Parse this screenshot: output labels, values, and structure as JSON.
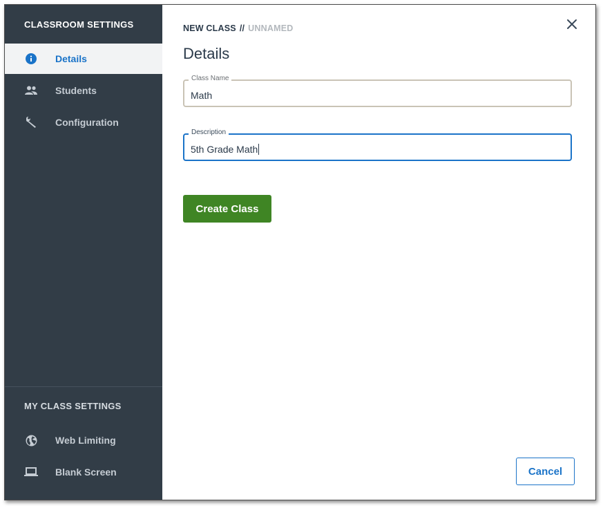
{
  "sidebar": {
    "heading": "CLASSROOM SETTINGS",
    "items": [
      {
        "label": "Details",
        "icon": "info-icon",
        "active": true
      },
      {
        "label": "Students",
        "icon": "people-icon",
        "active": false
      },
      {
        "label": "Configuration",
        "icon": "wrench-icon",
        "active": false
      }
    ],
    "my_heading": "MY CLASS SETTINGS",
    "my_items": [
      {
        "label": "Web Limiting",
        "icon": "globe-icon"
      },
      {
        "label": "Blank Screen",
        "icon": "laptop-icon"
      }
    ]
  },
  "breadcrumb": {
    "current": "NEW CLASS",
    "separator": "//",
    "name": "UNNAMED"
  },
  "page": {
    "title": "Details"
  },
  "form": {
    "class_name": {
      "label": "Class Name",
      "value": "Math"
    },
    "description": {
      "label": "Description",
      "value": "5th Grade Math"
    }
  },
  "buttons": {
    "create": "Create Class",
    "cancel": "Cancel"
  },
  "colors": {
    "sidebar_bg": "#323d47",
    "accent_blue": "#1a73c8",
    "create_green": "#3f8524"
  }
}
